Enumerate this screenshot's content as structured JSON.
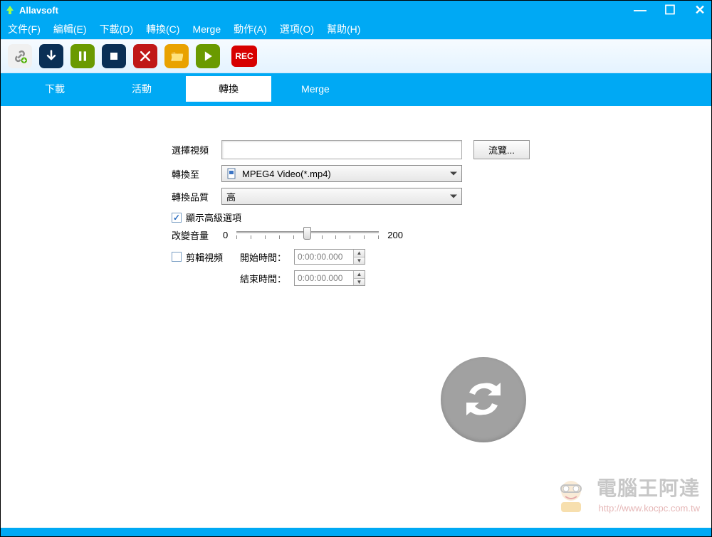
{
  "titlebar": {
    "title": "Allavsoft"
  },
  "menubar": {
    "file": "文件(F)",
    "edit": "編輯(E)",
    "download": "下載(D)",
    "convert": "轉換(C)",
    "merge": "Merge",
    "action": "動作(A)",
    "options": "選項(O)",
    "help": "幫助(H)"
  },
  "toolbar": {
    "rec_label": "REC"
  },
  "tabs": {
    "download": "下載",
    "activity": "活動",
    "convert": "轉換",
    "merge": "Merge"
  },
  "form": {
    "select_video_label": "選擇視頻",
    "browse_label": "流覽...",
    "convert_to_label": "轉換至",
    "convert_to_value": "MPEG4 Video(*.mp4)",
    "quality_label": "轉換品質",
    "quality_value": "高",
    "show_advanced_label": "顯示高級選項",
    "volume_label": "改變音量",
    "volume_min": "0",
    "volume_max": "200",
    "trim_label": "剪輯視頻",
    "start_time_label": "開始時間：",
    "end_time_label": "結束時間：",
    "start_time_value": "0:00:00.000",
    "end_time_value": "0:00:00.000"
  },
  "watermark": {
    "text": "電腦王阿達",
    "url": "http://www.kocpc.com.tw"
  }
}
